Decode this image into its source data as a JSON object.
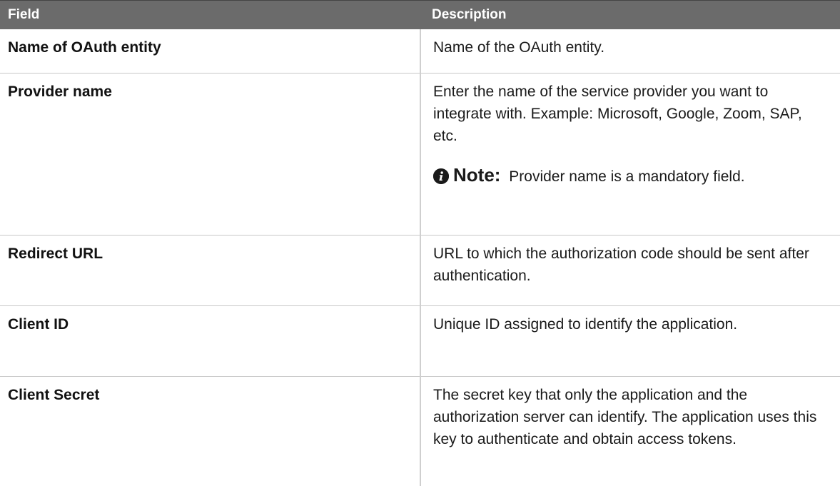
{
  "table": {
    "headers": {
      "field": "Field",
      "description": "Description"
    },
    "rows": [
      {
        "field": "Name of OAuth entity",
        "description": "Name of the OAuth entity."
      },
      {
        "field": "Provider name",
        "description": "Enter the name of the service provider you want to integrate with. Example: Microsoft, Google, Zoom, SAP, etc.",
        "note": {
          "icon": "info-icon",
          "label": "Note:",
          "text": "Provider name is a mandatory field."
        }
      },
      {
        "field": "Redirect URL",
        "description": "URL to which the authorization code should be sent after authentication."
      },
      {
        "field": "Client ID",
        "description": "Unique ID assigned to identify the application."
      },
      {
        "field": "Client Secret",
        "description": "The secret key that only the application and the authorization server can identify. The application uses this key to authenticate and obtain access tokens."
      }
    ]
  },
  "colors": {
    "header_bg": "#6b6b6b",
    "header_text": "#ffffff",
    "row_divider": "#c8c8c8"
  }
}
